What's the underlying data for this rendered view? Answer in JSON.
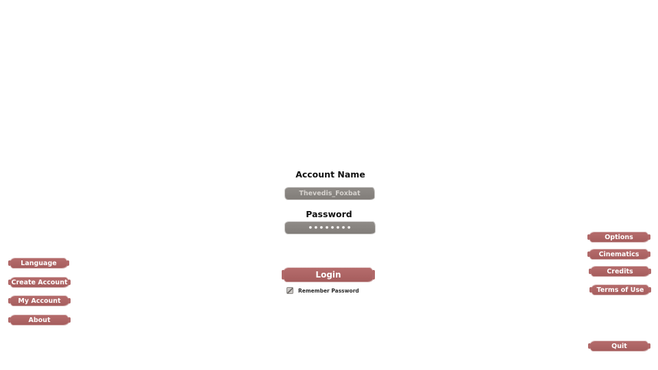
{
  "login": {
    "account_label": "Account Name",
    "account_value": "Thevedis_Foxbat",
    "password_label": "Password",
    "password_value": "••••••••",
    "login_label": "Login",
    "remember_label": "Remember Password"
  },
  "left_menu": {
    "language": "Language",
    "create_account": "Create Account",
    "my_account": "My Account",
    "about": "About"
  },
  "right_menu": {
    "options": "Options",
    "cinematics": "Cinematics",
    "credits": "Credits",
    "terms": "Terms of Use",
    "quit": "Quit"
  },
  "icons": {
    "remember": "checkbox-icon"
  },
  "colors": {
    "button": "#ad6464",
    "field": "#878380",
    "background": "#ffffff"
  }
}
